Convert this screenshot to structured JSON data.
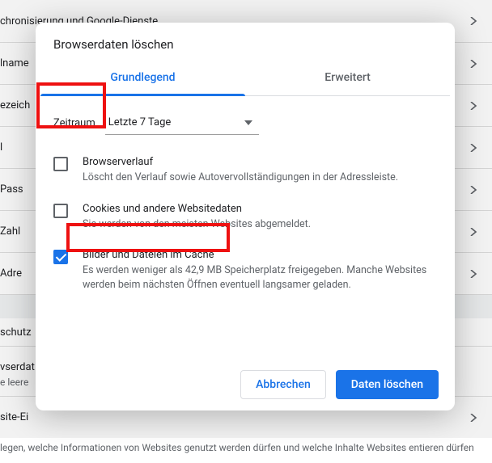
{
  "bg": {
    "rows": [
      "chronisierung und Google-Dienste",
      "lname",
      "ezeich",
      "l",
      "Pass",
      "Zahl",
      "Adre"
    ],
    "sec2": "schutz",
    "sec3a": "vserdat",
    "sec3b": "e leere",
    "sec4a": "site-Ei",
    "sec4b": "legen, welche Informationen von Websites genutzt werden dürfen und welche Inhalte Websites entieren dürfen"
  },
  "dialog": {
    "title": "Browserdaten löschen",
    "tabs": {
      "basic": "Grundlegend",
      "advanced": "Erweitert"
    },
    "time": {
      "label": "Zeitraum",
      "value": "Letzte 7 Tage"
    },
    "opts": [
      {
        "title": "Browserverlauf",
        "sub": "Löscht den Verlauf sowie Autovervollständigungen in der Adressleiste.",
        "checked": false
      },
      {
        "title": "Cookies und andere Websitedaten",
        "sub": "Sie werden von den meisten Websites abgemeldet.",
        "checked": false
      },
      {
        "title": "Bilder und Dateien im Cache",
        "sub": "Es werden weniger als 42,9 MB Speicherplatz freigegeben. Manche Websites werden beim nächsten Öffnen eventuell langsamer geladen.",
        "checked": true
      }
    ],
    "cancel": "Abbrechen",
    "confirm": "Daten löschen"
  }
}
